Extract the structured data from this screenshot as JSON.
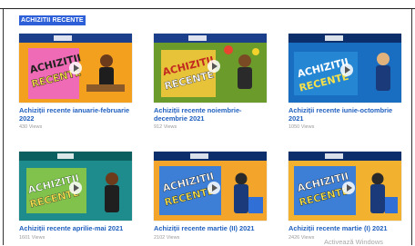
{
  "section": {
    "title": "ACHIZITII RECENTE"
  },
  "videos": [
    {
      "title": "Achiziții recente ianuarie-februarie 2022",
      "views": "430 Views"
    },
    {
      "title": "Achiziții recente noiembrie-decembrie 2021",
      "views": "912 Views"
    },
    {
      "title": "Achiziții recente iunie-octombrie 2021",
      "views": "1050 Views"
    },
    {
      "title": "Achiziții recente aprilie-mai 2021",
      "views": "1601 Views"
    },
    {
      "title": "Achiziții recente martie (II) 2021",
      "views": "2102 Views"
    },
    {
      "title": "Achiziții recente martie (I) 2021",
      "views": "2426 Views"
    }
  ],
  "thumbnails": [
    {
      "text_line1": "ACHIZITII",
      "text_line2": "RECENTE",
      "bg": "#f3a01e",
      "accent": "#d93a8a",
      "panel": "#f06bb5"
    },
    {
      "text_line1": "ACHIZITII",
      "text_line2": "RECENTE",
      "bg": "#6a9b2b",
      "accent": "#f0b516",
      "panel": "#e7c33a"
    },
    {
      "text_line1": "ACHIZITII",
      "text_line2": "RECENTE",
      "bg": "#1a6ec2",
      "accent": "#2fa0e6",
      "panel": "#1a4fa0"
    },
    {
      "text_line1": "ACHIZITII",
      "text_line2": "RECENTE",
      "bg": "#1e8c8c",
      "accent": "#9acf3c",
      "panel": "#3bb0a8"
    },
    {
      "text_line1": "ACHIZITII",
      "text_line2": "RECENTE",
      "bg": "#f2a52a",
      "accent": "#1f5fbf",
      "panel": "#3d7fd6"
    },
    {
      "text_line1": "ACHIZITII",
      "text_line2": "RECENTE",
      "bg": "#f2b12f",
      "accent": "#1f5fbf",
      "panel": "#3d7fd6"
    }
  ],
  "system": {
    "watermark": "Activează Windows"
  }
}
